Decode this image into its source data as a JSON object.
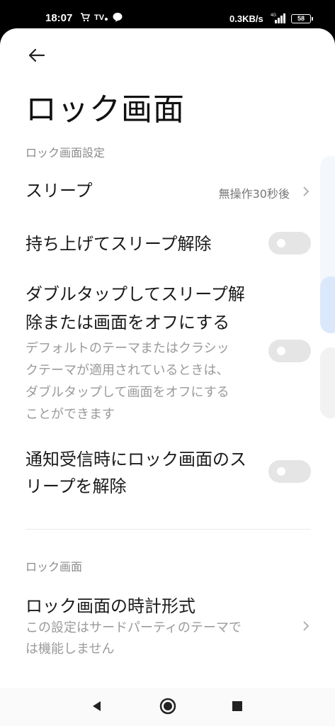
{
  "status": {
    "time": "18:07",
    "speed": "0.3KB/s",
    "battery": "58",
    "network": "4G"
  },
  "page": {
    "title": "ロック画面"
  },
  "sections": {
    "settings_header": "ロック画面設定",
    "lock_header": "ロック画面"
  },
  "rows": {
    "sleep": {
      "label": "スリープ",
      "value": "無操作30秒後"
    },
    "lift_wake": {
      "label": "持ち上げてスリープ解除",
      "enabled": false
    },
    "double_tap": {
      "label_line1": "ダブルタップしてスリープ解",
      "label_line2": "除または画面をオフにする",
      "desc_line1": "デフォルトのテーマまたはクラシッ",
      "desc_line2": "クテーマが適用されているときは、",
      "desc_line3": "ダブルタップして画面をオフにする",
      "desc_line4": "ことができます",
      "enabled": false
    },
    "notification_wake": {
      "label_line1": "通知受信時にロック画面のス",
      "label_line2": "リープを解除",
      "enabled": false
    },
    "clock_format": {
      "label": "ロック画面の時計形式",
      "desc_line1": "この設定はサードパーティのテーマで",
      "desc_line2": "は機能しません"
    }
  },
  "colors": {
    "toggle_off": "#e5e5e5",
    "accent_edge": "#dbe8fb"
  }
}
